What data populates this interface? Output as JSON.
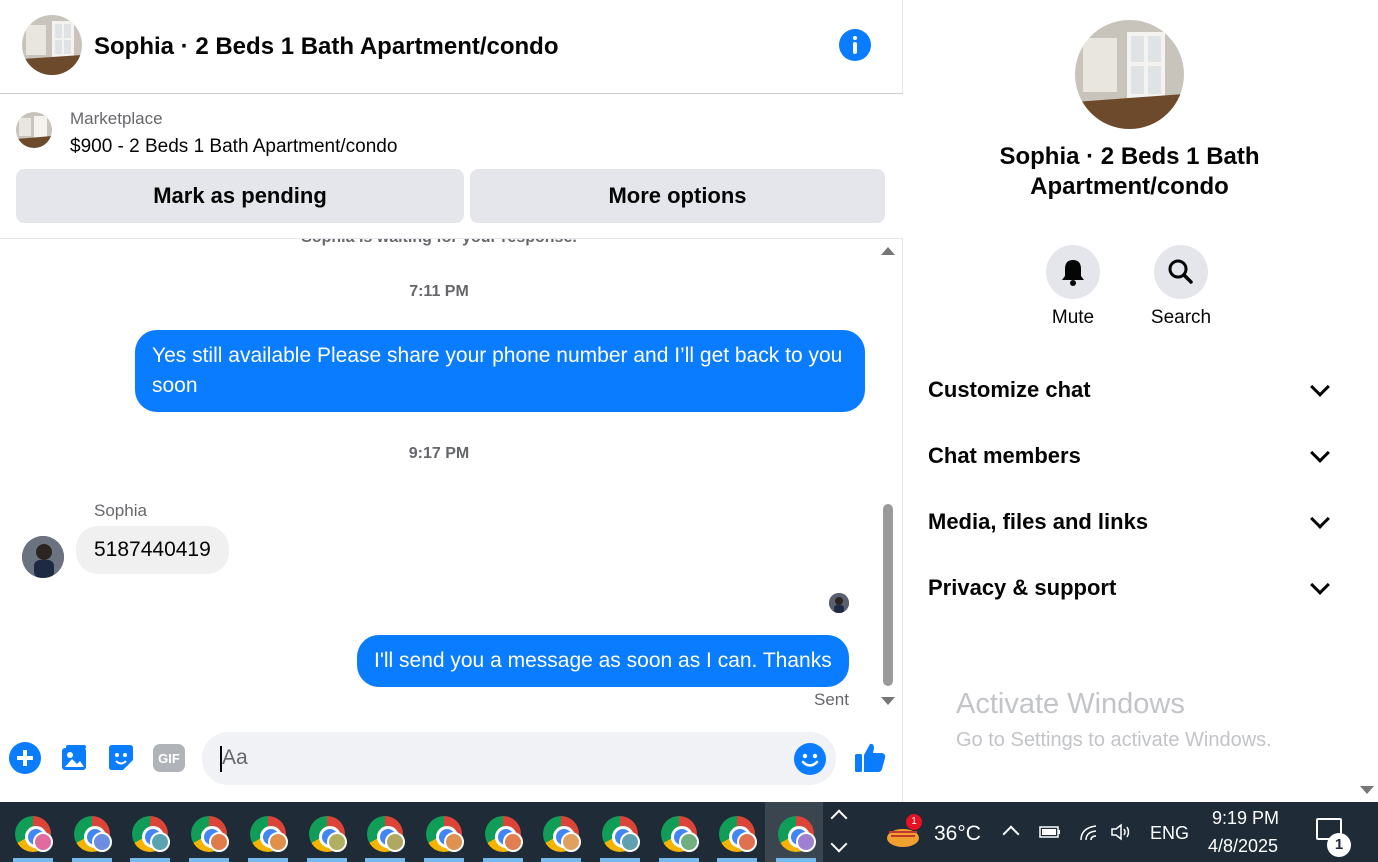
{
  "header": {
    "title": "Sophia · 2 Beds 1 Bath Apartment/condo"
  },
  "marketplace": {
    "label": "Marketplace",
    "product": "$900 - 2 Beds 1 Bath Apartment/condo",
    "mark_pending": "Mark as pending",
    "more_options": "More options"
  },
  "messages": {
    "waiting": "Sophia is waiting for your response.",
    "items": [
      {
        "type": "timestamp",
        "text": "7:11 PM"
      },
      {
        "type": "outgoing",
        "text": "Yes still available Please share your phone number and I’ll get back to you soon"
      },
      {
        "type": "timestamp",
        "text": "9:17 PM"
      },
      {
        "type": "sender",
        "text": "Sophia"
      },
      {
        "type": "incoming",
        "text": "5187440419"
      },
      {
        "type": "outgoing",
        "text": "I'll send you a message as soon as I can. Thanks"
      },
      {
        "type": "status",
        "text": "Sent"
      }
    ]
  },
  "composer": {
    "placeholder": "Aa",
    "gif_label": "GIF"
  },
  "info_panel": {
    "name": "Sophia · 2 Beds 1 Bath Apartment/condo",
    "actions": [
      {
        "label": "Mute",
        "icon": "bell-icon"
      },
      {
        "label": "Search",
        "icon": "search-icon"
      }
    ],
    "sections": [
      "Customize chat",
      "Chat members",
      "Media, files and links",
      "Privacy & support"
    ]
  },
  "watermark": {
    "title": "Activate Windows",
    "subtitle": "Go to Settings to activate Windows."
  },
  "taskbar": {
    "weather_badge": "1",
    "temperature": "36°C",
    "language": "ENG",
    "time": "9:19 PM",
    "date": "4/8/2025",
    "notification_count": "1",
    "profile_badge_colors": [
      "#e06c9f",
      "#6c8ee0",
      "#5aa3b0",
      "#e07c4a",
      "#e0904a",
      "#b0b060",
      "#b0a860",
      "#e09050",
      "#e08050",
      "#e0a060",
      "#60a0b0",
      "#70b080",
      "#e07050",
      "#a080d0"
    ]
  },
  "colors": {
    "accent": "#0a7cff",
    "taskbar": "#1f2b36"
  }
}
